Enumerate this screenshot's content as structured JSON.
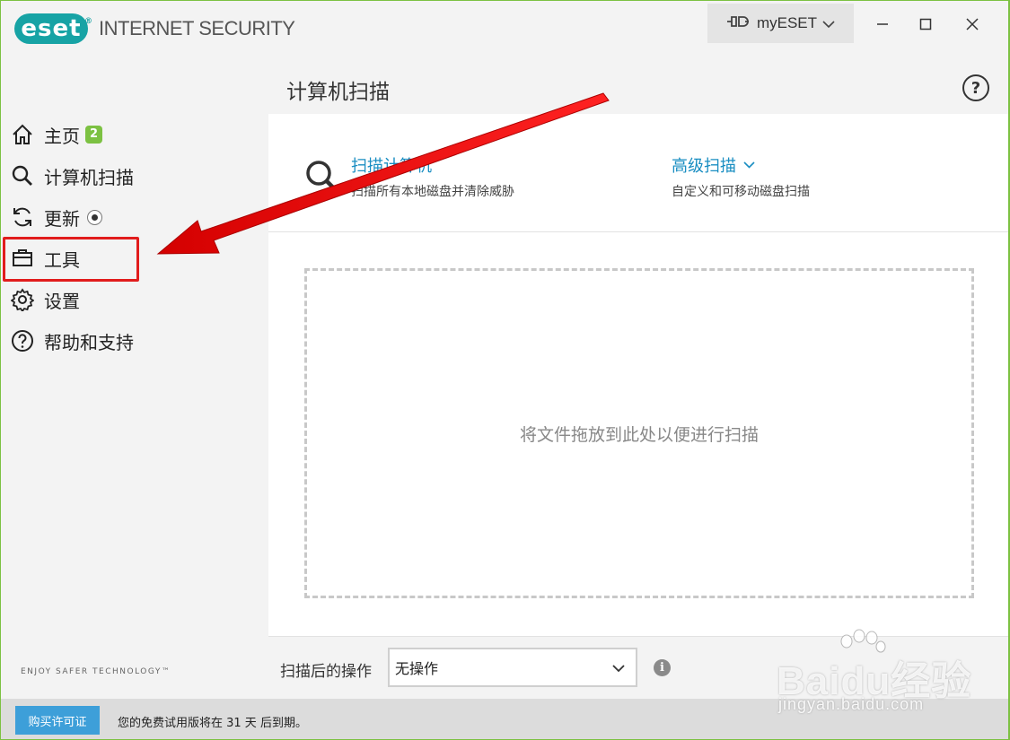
{
  "app": {
    "logo_text": "eset",
    "product_name": "INTERNET SECURITY",
    "tagline": "ENJOY SAFER TECHNOLOGY™"
  },
  "titlebar": {
    "myeset_label": "myESET"
  },
  "sidebar": {
    "items": [
      {
        "label": "主页",
        "icon": "home-icon",
        "badge": "2"
      },
      {
        "label": "计算机扫描",
        "icon": "search-icon"
      },
      {
        "label": "更新",
        "icon": "refresh-icon"
      },
      {
        "label": "工具",
        "icon": "toolbox-icon",
        "highlighted": true
      },
      {
        "label": "设置",
        "icon": "gear-icon"
      },
      {
        "label": "帮助和支持",
        "icon": "help-icon"
      }
    ]
  },
  "main": {
    "title": "计算机扫描",
    "scan_computer": {
      "title": "扫描计算机",
      "desc": "扫描所有本地磁盘并清除威胁"
    },
    "advanced_scan": {
      "title": "高级扫描",
      "desc": "自定义和可移动磁盘扫描"
    },
    "dropzone_text": "将文件拖放到此处以便进行扫描",
    "after_scan_label": "扫描后的操作",
    "after_scan_value": "无操作"
  },
  "statusbar": {
    "buy_button": "购买许可证",
    "trial_text": "您的免费试用版将在 31 天 后到期。"
  },
  "watermark": {
    "main": "Baidu经验",
    "sub": "jingyan.baidu.com"
  },
  "colors": {
    "brand_teal": "#17a3a5",
    "accent_green": "#7cc142",
    "link_blue": "#1a8ec2",
    "highlight_red": "#e11c1c",
    "button_blue": "#3d9fd9"
  }
}
